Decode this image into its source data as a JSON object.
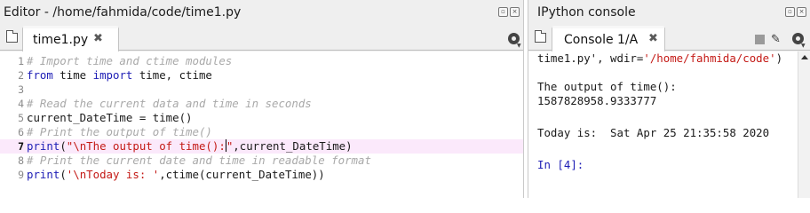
{
  "editor": {
    "title": "Editor - /home/fahmida/code/time1.py",
    "tab_label": "time1.py",
    "tab_close": "✖",
    "lines": [
      {
        "num": "1",
        "parts": [
          {
            "t": "# Import time and ctime modules",
            "c": "cm"
          }
        ]
      },
      {
        "num": "2",
        "parts": [
          {
            "t": "from",
            "c": "kw"
          },
          {
            "t": " time ",
            "c": "nm"
          },
          {
            "t": "import",
            "c": "kw"
          },
          {
            "t": " time, ctime",
            "c": "nm"
          }
        ]
      },
      {
        "num": "3",
        "parts": []
      },
      {
        "num": "4",
        "parts": [
          {
            "t": "# Read the current data and time in seconds",
            "c": "cm"
          }
        ]
      },
      {
        "num": "5",
        "parts": [
          {
            "t": "current_DateTime = time()",
            "c": "nm"
          }
        ]
      },
      {
        "num": "6",
        "parts": [
          {
            "t": "# Print the output of time()",
            "c": "cm"
          }
        ]
      },
      {
        "num": "7",
        "current": true,
        "parts": [
          {
            "t": "print",
            "c": "kw"
          },
          {
            "t": "(",
            "c": "nm"
          },
          {
            "t": "\"\\nThe output of time():",
            "c": "str"
          },
          {
            "t": "",
            "c": "cursor"
          },
          {
            "t": "\"",
            "c": "str"
          },
          {
            "t": ",current_DateTime)",
            "c": "nm"
          }
        ]
      },
      {
        "num": "8",
        "parts": [
          {
            "t": "# Print the current date and time in readable format",
            "c": "cm"
          }
        ]
      },
      {
        "num": "9",
        "parts": [
          {
            "t": "print",
            "c": "kw"
          },
          {
            "t": "(",
            "c": "nm"
          },
          {
            "t": "'\\nToday is: '",
            "c": "str"
          },
          {
            "t": ",ctime(current_DateTime))",
            "c": "nm"
          }
        ]
      }
    ]
  },
  "console": {
    "title": "IPython console",
    "tab_label": "Console 1/A",
    "tab_close": "✖",
    "lines": [
      [
        {
          "t": "time1.py', wdir=",
          "c": "nm"
        },
        {
          "t": "'/home/fahmida/code'",
          "c": "str"
        },
        {
          "t": ")",
          "c": "nm"
        }
      ],
      [],
      [
        {
          "t": "The output of time():",
          "c": "nm"
        }
      ],
      [
        {
          "t": "1587828958.9333777",
          "c": "nm"
        }
      ],
      [],
      [
        {
          "t": "Today is:  Sat Apr 25 21:35:58 2020",
          "c": "nm"
        }
      ],
      [],
      [
        {
          "t": "In [",
          "c": "con-prompt"
        },
        {
          "t": "4",
          "c": "con-prompt"
        },
        {
          "t": "]:",
          "c": "con-prompt"
        }
      ]
    ]
  },
  "icons": {
    "window_buttons": [
      "undock-icon",
      "close-pane-icon"
    ],
    "editor_toolbar": [
      "browse-tabs-icon",
      "options-gear-icon"
    ],
    "console_toolbar": [
      "browse-tabs-icon",
      "stop-icon",
      "clear-brush-icon",
      "options-gear-icon"
    ]
  },
  "colors": {
    "keyword": "#1d1db5",
    "string": "#c41a16",
    "comment": "#a9a9a9",
    "current_line": "#fbe9fb"
  }
}
